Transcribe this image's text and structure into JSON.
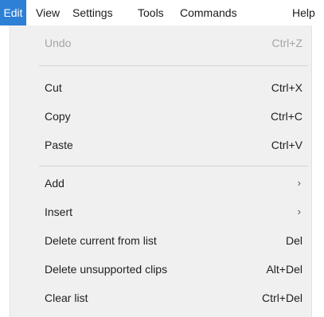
{
  "menubar": {
    "edit": "Edit",
    "view": "View",
    "settings": "Settings",
    "tools": "Tools",
    "commands": "Commands",
    "help": "Help"
  },
  "edit_menu": {
    "undo": {
      "label": "Undo",
      "shortcut": "Ctrl+Z",
      "enabled": false
    },
    "cut": {
      "label": "Cut",
      "shortcut": "Ctrl+X"
    },
    "copy": {
      "label": "Copy",
      "shortcut": "Ctrl+C"
    },
    "paste": {
      "label": "Paste",
      "shortcut": "Ctrl+V"
    },
    "add": {
      "label": "Add",
      "submenu_arrow": "›"
    },
    "insert": {
      "label": "Insert",
      "submenu_arrow": "›"
    },
    "delete_current": {
      "label": "Delete current from list",
      "shortcut": "Del"
    },
    "delete_unsupported": {
      "label": "Delete unsupported clips",
      "shortcut": "Alt+Del"
    },
    "clear_list": {
      "label": "Clear list",
      "shortcut": "Ctrl+Del"
    }
  },
  "colors": {
    "active_menu_bg": "#2e7fd6",
    "dropdown_bg": "#f0f0f0",
    "disabled_text": "#a4a4a4"
  }
}
